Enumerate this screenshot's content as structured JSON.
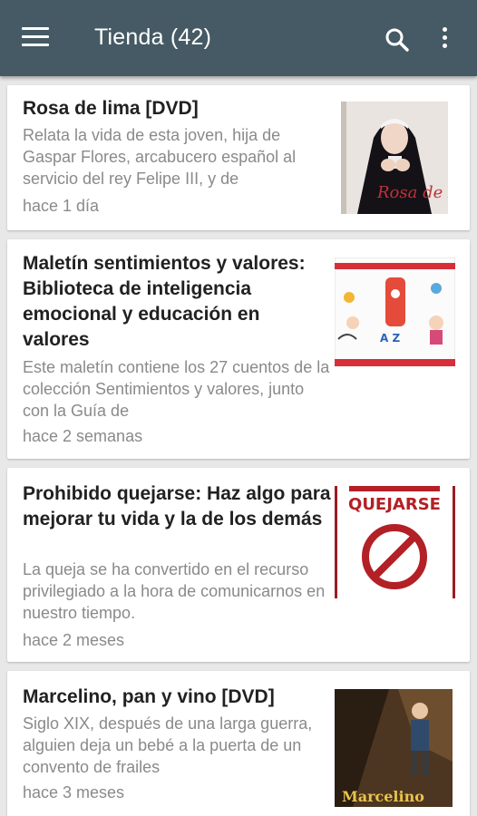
{
  "appbar": {
    "title": "Tienda (42)",
    "menu_icon": "hamburger-menu-icon",
    "search_icon": "search-icon",
    "more_icon": "more-vertical-icon",
    "color": "#455a64"
  },
  "items": [
    {
      "title": "Rosa de lima [DVD]",
      "description": "Relata la vida de esta joven, hija de Gaspar Flores, arcabucero español al servicio del rey Felipe III, y de",
      "time": "hace 1 día",
      "thumb_text": "Rosa de Lima"
    },
    {
      "title": "Maletín sentimientos y valores: Biblioteca de inteligencia emocional y educación en valores",
      "description": "Este maletín contiene los 27 cuentos de la colección Sentimientos y valores, junto con la Guía de",
      "time": "hace 2 semanas",
      "thumb_text": "A Z"
    },
    {
      "title": "Prohibido quejarse: Haz algo para mejorar tu vida y la de los demás",
      "description": "La queja se ha convertido en el recurso privilegiado a la hora de comunicarnos en nuestro tiempo.",
      "time": "hace 2 meses",
      "thumb_text": "QUEJARSE"
    },
    {
      "title": "Marcelino, pan y vino [DVD]",
      "description": "Siglo XIX, después de una larga guerra, alguien deja un bebé a la puerta de un convento de frailes",
      "time": "hace 3 meses",
      "thumb_text": "Marcelino"
    }
  ]
}
